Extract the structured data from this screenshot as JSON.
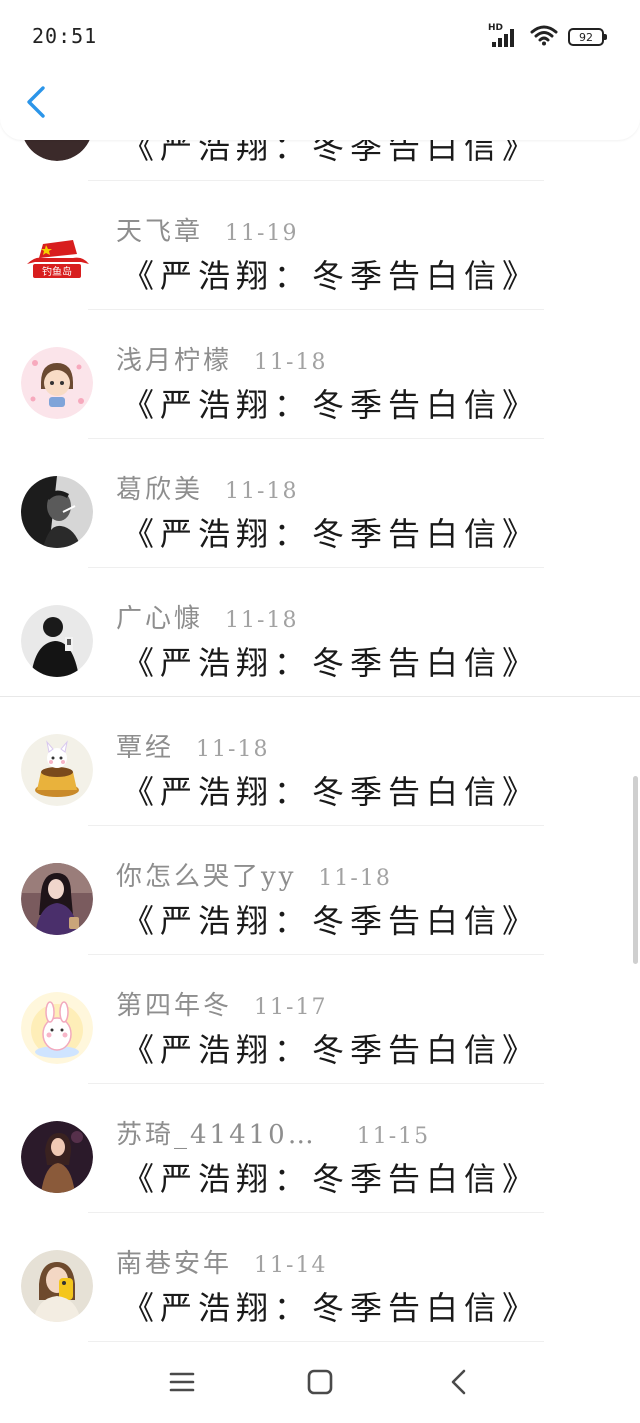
{
  "status_bar": {
    "time": "20:51",
    "network": "HD",
    "battery": "92"
  },
  "header": {
    "back_icon": "chevron-left-icon",
    "accent_color": "#2b95e9"
  },
  "comments": [
    {
      "user": "",
      "date": "",
      "message": "《严浩翔：冬季告白信》",
      "avatar": "dark-round"
    },
    {
      "user": "天飞章",
      "date": "11-19",
      "message": "《严浩翔：冬季告白信》",
      "avatar": "red-flag-logo"
    },
    {
      "user": "浅月柠檬",
      "date": "11-18",
      "message": "《严浩翔：冬季告白信》",
      "avatar": "pink-cartoon-girl"
    },
    {
      "user": "葛欣美",
      "date": "11-18",
      "message": "《严浩翔：冬季告白信》",
      "avatar": "bw-man-smoking"
    },
    {
      "user": "广心慷",
      "date": "11-18",
      "message": "《严浩翔：冬季告白信》",
      "avatar": "bw-figure"
    },
    {
      "user": "覃经",
      "date": "11-18",
      "message": "《严浩翔：冬季告白信》",
      "avatar": "pudding-cartoon"
    },
    {
      "user": "你怎么哭了yy",
      "date": "11-18",
      "message": "《严浩翔：冬季告白信》",
      "avatar": "girl-purple-photo"
    },
    {
      "user": "第四年冬",
      "date": "11-17",
      "message": "《严浩翔：冬季告白信》",
      "avatar": "bunny-cartoon"
    },
    {
      "user": "苏琦_41410…",
      "date": "11-15",
      "message": "《严浩翔：冬季告白信》",
      "avatar": "girl-dark-photo"
    },
    {
      "user": "南巷安年",
      "date": "11-14",
      "message": "《严浩翔：冬季告白信》",
      "avatar": "girl-yellow-phone"
    }
  ],
  "nav_bar": {
    "menu_icon": "menu-icon",
    "home_icon": "home-square-icon",
    "back_icon": "back-triangle-icon"
  }
}
